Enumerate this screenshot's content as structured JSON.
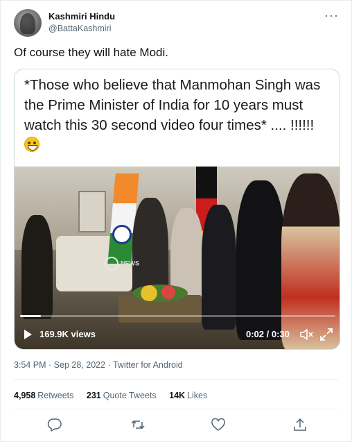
{
  "author": {
    "name": "Kashmiri Hindu",
    "handle": "@BattaKashmiri"
  },
  "more_icon": "more-horizontal-icon",
  "tweet_text": "Of course they will hate Modi.",
  "media": {
    "caption": "*Those who believe that Manmohan Singh was the Prime Minister of India for 10 years must watch this 30 second video four times* .... !!!!!! ",
    "caption_emoji": "grinning-face-emoji",
    "video": {
      "views": "169.9K views",
      "timecode": "0:02 / 0:30",
      "progress": 0.067,
      "watermark": "NEWS"
    }
  },
  "meta": {
    "time": "3:54 PM",
    "separator": " · ",
    "date": "Sep 28, 2022",
    "source": "Twitter for Android"
  },
  "stats": [
    {
      "count": "4,958",
      "label": "Retweets"
    },
    {
      "count": "231",
      "label": "Quote Tweets"
    },
    {
      "count": "14K",
      "label": "Likes"
    }
  ],
  "actions": [
    "reply-icon",
    "retweet-icon",
    "like-icon",
    "share-icon"
  ],
  "colors": {
    "text": "#0f1419",
    "secondary": "#536471",
    "border": "#cfd9de"
  }
}
